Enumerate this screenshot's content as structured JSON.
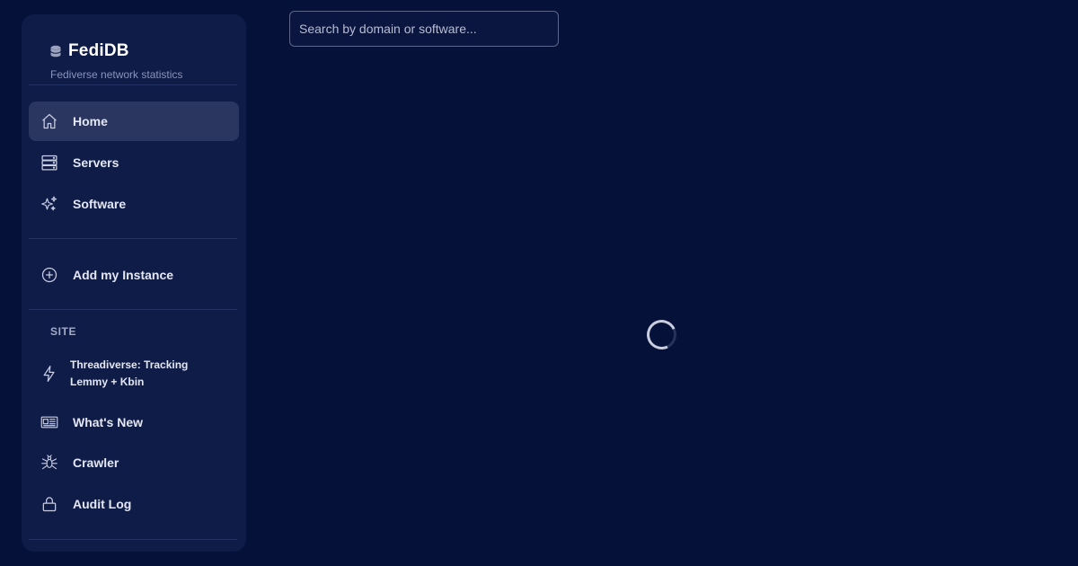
{
  "brand": {
    "title": "FediDB",
    "subtitle": "Fediverse network statistics",
    "icon": "database-icon"
  },
  "nav": {
    "main": [
      {
        "label": "Home",
        "icon": "home-icon",
        "active": true
      },
      {
        "label": "Servers",
        "icon": "server-icon",
        "active": false
      },
      {
        "label": "Software",
        "icon": "sparkles-icon",
        "active": false
      }
    ],
    "add_instance": {
      "label": "Add my Instance",
      "icon": "plus-circle-icon"
    },
    "site_section_title": "SITE",
    "site": [
      {
        "label": "Threadiverse: Tracking Lemmy + Kbin",
        "icon": "bolt-icon"
      },
      {
        "label": "What's New",
        "icon": "newspaper-icon"
      },
      {
        "label": "Crawler",
        "icon": "bug-icon"
      },
      {
        "label": "Audit Log",
        "icon": "lock-icon"
      }
    ]
  },
  "search": {
    "placeholder": "Search by domain or software..."
  },
  "main": {
    "loading_indicator": "spinner-icon"
  },
  "colors": {
    "background": "#06113a",
    "sidebar": "#101c48",
    "active_item": "#2a365f",
    "text": "#e3e7f3",
    "muted": "#8a93b8"
  }
}
